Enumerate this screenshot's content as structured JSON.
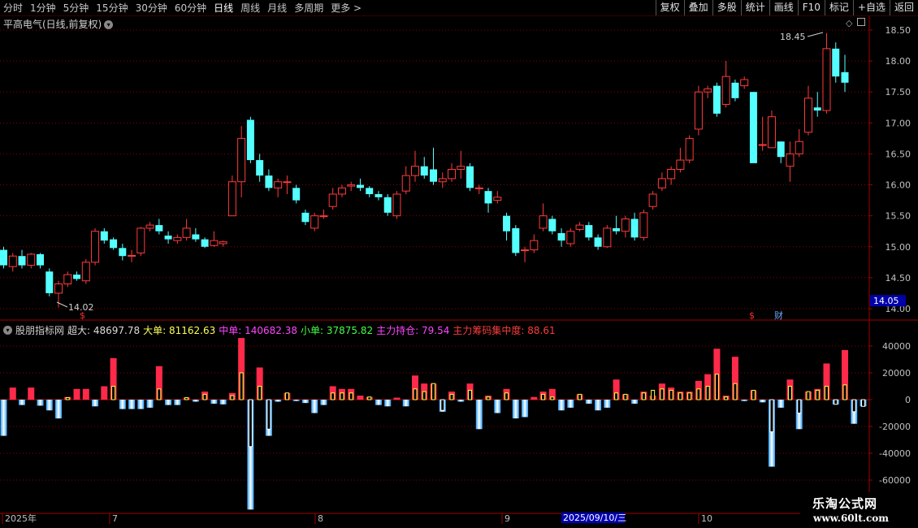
{
  "toolbar": {
    "periods": [
      "分时",
      "1分钟",
      "5分钟",
      "15分钟",
      "30分钟",
      "60分钟",
      "日线",
      "周线",
      "月线",
      "多周期",
      "更多 >"
    ],
    "active_period": "日线",
    "right_buttons": [
      "复权",
      "叠加",
      "多股",
      "统计",
      "画线",
      "F10",
      "标记",
      "+自选",
      "返回"
    ]
  },
  "main_chart": {
    "title": "平高电气(日线,前复权)",
    "high_label": "18.45",
    "low_label": "14.02",
    "current_price": "14.05",
    "markers": [
      "$",
      "$",
      "财"
    ],
    "y_ticks": [
      "18.50",
      "18.00",
      "17.50",
      "17.00",
      "16.50",
      "16.00",
      "15.50",
      "15.00",
      "14.50",
      "14.00"
    ],
    "colors": {
      "up": "#ff3b3b",
      "down": "#54ffff",
      "grid": "#8b0000"
    }
  },
  "indicator": {
    "name": "股朋指标网",
    "fields": [
      {
        "label": "超大:",
        "value": "48697.78",
        "color": "#dcdcdc"
      },
      {
        "label": "大单:",
        "value": "81162.63",
        "color": "#ffff55"
      },
      {
        "label": "中单:",
        "value": "140682.38",
        "color": "#ff44ff"
      },
      {
        "label": "小单:",
        "value": "37875.82",
        "color": "#44ff44"
      },
      {
        "label": "主力持仓:",
        "value": "79.54",
        "color": "#ff44ff"
      },
      {
        "label": "主力筹码集中度:",
        "value": "88.61",
        "color": "#ff3b3b"
      }
    ],
    "y_ticks": [
      "40000",
      "20000",
      "0",
      "-20000",
      "-40000",
      "-60000"
    ]
  },
  "date_axis": {
    "labels": [
      "2025年",
      "7",
      "8",
      "9",
      "10"
    ],
    "cursor_date": "2025/09/10/三"
  },
  "watermark": {
    "line1": "乐淘公式网",
    "line2": "www.60lt.com"
  },
  "chart_data": [
    {
      "type": "candlestick",
      "title": "平高电气(日线,前复权)",
      "ylim": [
        13.95,
        18.6
      ],
      "candles": [
        [
          14.95,
          14.7,
          15.0,
          14.65
        ],
        [
          14.68,
          14.85,
          14.9,
          14.6
        ],
        [
          14.85,
          14.7,
          14.95,
          14.65
        ],
        [
          14.7,
          14.88,
          14.9,
          14.65
        ],
        [
          14.88,
          14.7,
          14.9,
          14.65
        ],
        [
          14.6,
          14.25,
          14.65,
          14.2
        ],
        [
          14.25,
          14.4,
          14.45,
          14.02
        ],
        [
          14.4,
          14.55,
          14.6,
          14.35
        ],
        [
          14.55,
          14.48,
          14.6,
          14.45
        ],
        [
          14.45,
          14.75,
          14.8,
          14.4
        ],
        [
          14.75,
          15.25,
          15.3,
          14.7
        ],
        [
          15.25,
          15.1,
          15.3,
          15.05
        ],
        [
          15.12,
          14.98,
          15.15,
          14.95
        ],
        [
          14.98,
          14.85,
          15.05,
          14.78
        ],
        [
          14.85,
          14.86,
          14.95,
          14.75
        ],
        [
          14.9,
          15.3,
          15.32,
          14.85
        ],
        [
          15.3,
          15.35,
          15.4,
          15.25
        ],
        [
          15.35,
          15.25,
          15.45,
          15.2
        ],
        [
          15.18,
          15.12,
          15.25,
          15.05
        ],
        [
          15.1,
          15.15,
          15.2,
          15.05
        ],
        [
          15.15,
          15.3,
          15.45,
          15.1
        ],
        [
          15.2,
          15.12,
          15.3,
          15.08
        ],
        [
          15.12,
          15.0,
          15.15,
          14.98
        ],
        [
          15.02,
          15.1,
          15.25,
          15.0
        ],
        [
          15.05,
          15.08,
          15.1,
          15.0
        ],
        [
          15.5,
          16.05,
          16.15,
          15.6
        ],
        [
          16.05,
          16.75,
          16.95,
          15.8
        ],
        [
          17.05,
          16.4,
          17.1,
          16.35
        ],
        [
          16.4,
          16.15,
          16.5,
          16.05
        ],
        [
          16.15,
          15.95,
          16.25,
          15.9
        ],
        [
          15.95,
          16.05,
          16.1,
          15.8
        ],
        [
          16.05,
          16.05,
          16.15,
          15.85
        ],
        [
          15.95,
          15.75,
          16.0,
          15.7
        ],
        [
          15.55,
          15.4,
          15.6,
          15.35
        ],
        [
          15.3,
          15.5,
          15.55,
          15.25
        ],
        [
          15.5,
          15.5,
          15.6,
          15.45
        ],
        [
          15.65,
          15.85,
          15.95,
          15.6
        ],
        [
          15.85,
          15.95,
          16.0,
          15.8
        ],
        [
          15.98,
          16.0,
          16.05,
          15.9
        ],
        [
          16.0,
          15.95,
          16.1,
          15.9
        ],
        [
          15.95,
          15.85,
          15.98,
          15.8
        ],
        [
          15.85,
          15.8,
          15.9,
          15.75
        ],
        [
          15.8,
          15.55,
          15.85,
          15.5
        ],
        [
          15.5,
          15.85,
          15.9,
          15.45
        ],
        [
          15.9,
          16.15,
          16.3,
          15.85
        ],
        [
          16.15,
          16.3,
          16.55,
          16.05
        ],
        [
          16.3,
          16.15,
          16.45,
          16.1
        ],
        [
          16.25,
          16.05,
          16.6,
          16.0
        ],
        [
          16.05,
          16.1,
          16.2,
          15.95
        ],
        [
          16.1,
          16.25,
          16.35,
          16.05
        ],
        [
          16.25,
          16.3,
          16.55,
          16.1
        ],
        [
          16.3,
          15.95,
          16.35,
          15.9
        ],
        [
          15.95,
          15.95,
          16.0,
          15.85
        ],
        [
          15.9,
          15.7,
          15.95,
          15.55
        ],
        [
          15.75,
          15.8,
          15.9,
          15.7
        ],
        [
          15.5,
          15.25,
          15.55,
          15.1
        ],
        [
          15.3,
          14.9,
          15.35,
          14.85
        ],
        [
          14.95,
          14.95,
          15.0,
          14.75
        ],
        [
          14.95,
          15.1,
          15.2,
          14.9
        ],
        [
          15.3,
          15.5,
          15.7,
          15.25
        ],
        [
          15.45,
          15.25,
          15.5,
          15.2
        ],
        [
          15.22,
          15.1,
          15.3,
          15.0
        ],
        [
          15.05,
          15.25,
          15.3,
          15.0
        ],
        [
          15.28,
          15.35,
          15.4,
          15.25
        ],
        [
          15.35,
          15.15,
          15.4,
          15.1
        ],
        [
          15.15,
          15.0,
          15.2,
          14.95
        ],
        [
          15.0,
          15.3,
          15.35,
          14.98
        ],
        [
          15.3,
          15.25,
          15.5,
          15.2
        ],
        [
          15.25,
          15.45,
          15.5,
          15.15
        ],
        [
          15.45,
          15.15,
          15.55,
          15.1
        ],
        [
          15.15,
          15.55,
          15.6,
          15.1
        ],
        [
          15.65,
          15.85,
          15.9,
          15.6
        ],
        [
          15.95,
          16.1,
          16.2,
          15.9
        ],
        [
          16.1,
          16.25,
          16.3,
          16.0
        ],
        [
          16.25,
          16.4,
          16.6,
          16.2
        ],
        [
          16.4,
          16.75,
          16.8,
          16.35
        ],
        [
          16.9,
          17.5,
          17.6,
          16.8
        ],
        [
          17.5,
          17.55,
          17.6,
          17.4
        ],
        [
          17.6,
          17.15,
          17.65,
          17.1
        ],
        [
          17.3,
          17.75,
          18.0,
          17.25
        ],
        [
          17.65,
          17.4,
          17.7,
          17.35
        ],
        [
          17.6,
          17.7,
          17.75,
          17.55
        ],
        [
          17.5,
          16.35,
          17.5,
          16.35
        ],
        [
          16.65,
          16.65,
          17.1,
          16.55
        ],
        [
          16.6,
          17.1,
          17.2,
          16.6
        ],
        [
          16.7,
          16.45,
          16.7,
          16.35
        ],
        [
          16.3,
          16.5,
          16.7,
          16.05
        ],
        [
          16.5,
          16.7,
          16.9,
          16.45
        ],
        [
          16.85,
          17.4,
          17.6,
          16.8
        ],
        [
          17.25,
          17.2,
          17.5,
          17.1
        ],
        [
          17.2,
          18.2,
          18.45,
          17.15
        ],
        [
          18.2,
          17.75,
          18.3,
          17.65
        ],
        [
          17.82,
          17.65,
          18.1,
          17.5
        ]
      ]
    },
    {
      "type": "bar",
      "title": "股朋指标网",
      "ylim": [
        -82000,
        57000
      ],
      "series_names": [
        "超大",
        "大单"
      ],
      "values_a": [
        -27000,
        9000,
        -4000,
        9000,
        -4500,
        -8000,
        -14000,
        2000,
        8000,
        8000,
        -5000,
        10000,
        31000,
        -7000,
        -7000,
        -7000,
        -6000,
        25000,
        -4000,
        -4000,
        1500,
        -1500,
        6000,
        -3000,
        -3500,
        5000,
        46000,
        -82000,
        24000,
        -27000,
        -1500,
        5000,
        -1000,
        -2500,
        -10000,
        -4000,
        10000,
        8000,
        8000,
        3000,
        2000,
        -4000,
        -5000,
        1500,
        -5000,
        18000,
        12000,
        12000,
        -9000,
        6000,
        -1500,
        12000,
        -22000,
        3000,
        -10000,
        8000,
        -14000,
        -13000,
        2000,
        6000,
        8000,
        -8000,
        -6000,
        4000,
        -3000,
        -8000,
        -6000,
        15000,
        4000,
        -3000,
        6000,
        3000,
        12000,
        9000,
        6000,
        6000,
        14000,
        19000,
        38000,
        3000,
        32000,
        -1000,
        7000,
        -2000,
        -50000,
        -6000,
        15000,
        -22000,
        6000,
        8000,
        27000,
        -3500,
        37000,
        -18000,
        -5000
      ],
      "values_b": [
        0,
        0,
        0,
        0,
        0,
        0,
        0,
        1500,
        0,
        0,
        0,
        0,
        10000,
        0,
        0,
        0,
        0,
        8000,
        0,
        0,
        1500,
        0,
        4000,
        0,
        0,
        3000,
        20000,
        -35000,
        10000,
        -22000,
        0,
        5000,
        0,
        0,
        0,
        0,
        5000,
        5000,
        5000,
        0,
        2000,
        0,
        0,
        0,
        0,
        8000,
        6000,
        12000,
        -8000,
        4000,
        0,
        7000,
        0,
        2000,
        0,
        5000,
        0,
        0,
        0,
        4000,
        2000,
        0,
        0,
        4000,
        0,
        0,
        0,
        5000,
        4000,
        0,
        5000,
        7000,
        8000,
        7000,
        5000,
        5000,
        8000,
        10000,
        19000,
        2000,
        12000,
        0,
        7000,
        0,
        -24000,
        0,
        10000,
        -10000,
        6000,
        7000,
        10000,
        -3500,
        11000,
        -9000,
        -5000
      ]
    }
  ]
}
